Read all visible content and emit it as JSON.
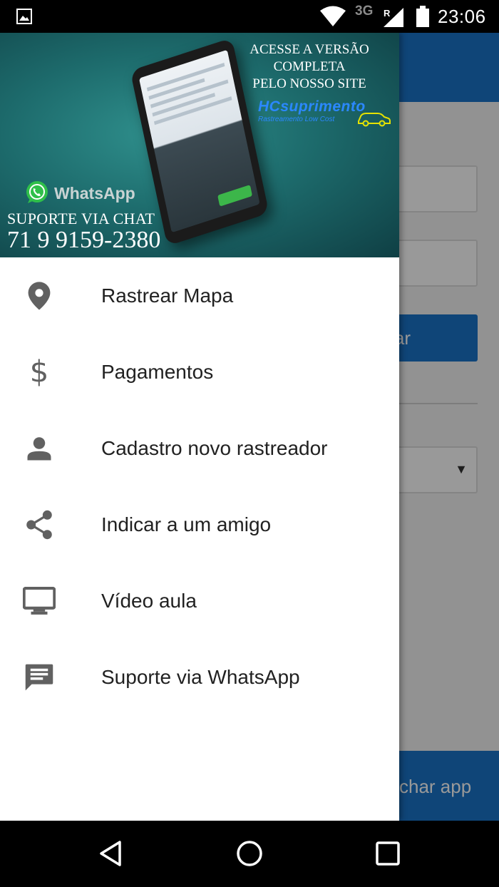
{
  "status_bar": {
    "network": "3G",
    "roaming_indicator": "R",
    "time": "23:06",
    "icons": [
      "gallery-icon",
      "wifi-icon",
      "signal-icon",
      "battery-icon"
    ]
  },
  "background_app": {
    "primary_button_label_fragment": "ar",
    "bottom_button_label_fragment": "char app",
    "select_arrow": "▼",
    "colors": {
      "accent": "#1a73c9"
    }
  },
  "banner": {
    "promo_lines": [
      "ACESSE A VERSÃO",
      "COMPLETA",
      "PELO NOSSO SITE"
    ],
    "brand_name": "HCsuprimento",
    "brand_tagline": "Rastreamento Low Cost",
    "whatsapp_label": "WhatsApp",
    "support_title": "SUPORTE VIA CHAT",
    "phone_number": "71 9 9159-2380"
  },
  "menu": {
    "items": [
      {
        "icon": "location-pin-icon",
        "label": "Rastrear Mapa"
      },
      {
        "icon": "dollar-icon",
        "label": "Pagamentos"
      },
      {
        "icon": "person-icon",
        "label": "Cadastro novo rastreador"
      },
      {
        "icon": "share-icon",
        "label": "Indicar a um amigo"
      },
      {
        "icon": "monitor-icon",
        "label": "Vídeo aula"
      },
      {
        "icon": "chat-icon",
        "label": "Suporte via WhatsApp"
      }
    ]
  },
  "nav_bar": {
    "buttons": [
      "back-icon",
      "home-icon",
      "recents-icon"
    ]
  }
}
